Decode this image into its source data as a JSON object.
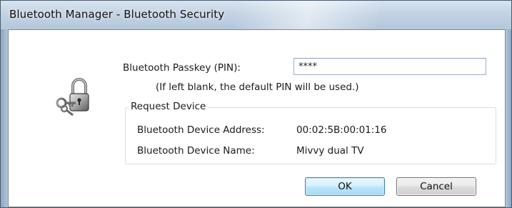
{
  "window": {
    "title": "Bluetooth Manager - Bluetooth Security"
  },
  "icon": {
    "name": "lock-with-keys-icon"
  },
  "form": {
    "passkey_label": "Bluetooth Passkey (PIN):",
    "pin_value": "****",
    "hint": "(If left blank, the default PIN will be used.)"
  },
  "request_device": {
    "legend": "Request Device",
    "address_label": "Bluetooth Device Address:",
    "address_value": "00:02:5B:00:01:16",
    "name_label": "Bluetooth Device Name:",
    "name_value": "Mivvy dual TV"
  },
  "buttons": {
    "ok_label": "OK",
    "cancel_label": "Cancel"
  },
  "colors": {
    "titlebar": "#c3d3e4",
    "frame": "#9fb6cf",
    "default_button_border": "#3c7fb1"
  }
}
